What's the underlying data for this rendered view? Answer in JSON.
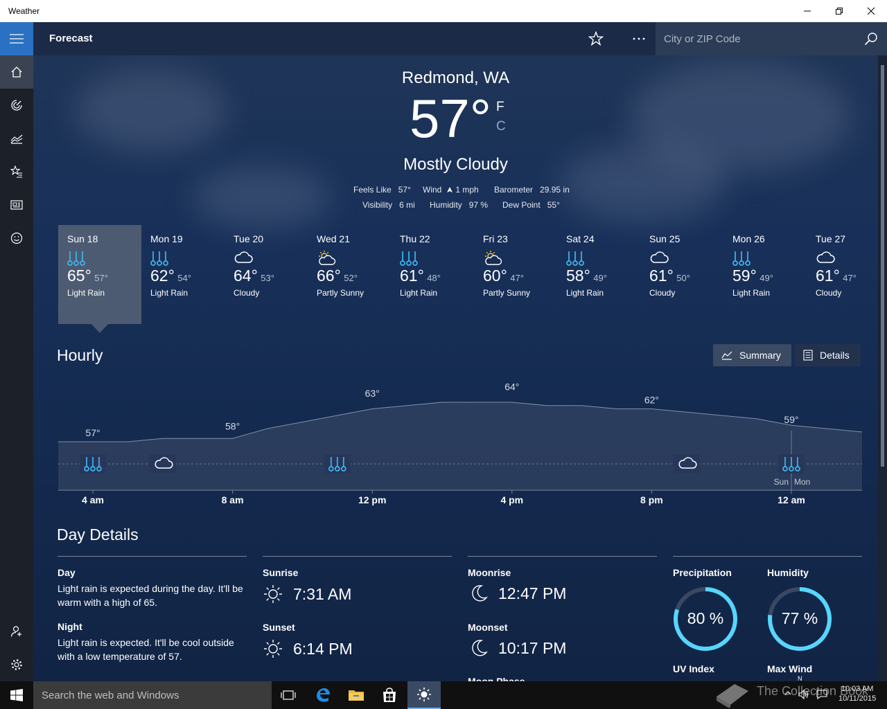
{
  "window": {
    "title": "Weather"
  },
  "topbar": {
    "title": "Forecast",
    "search_placeholder": "City or ZIP Code"
  },
  "current": {
    "location": "Redmond, WA",
    "temp": "57°",
    "unit_f": "F",
    "unit_c": "C",
    "condition": "Mostly Cloudy",
    "feels_like_label": "Feels Like",
    "feels_like": "57°",
    "wind_label": "Wind",
    "wind": "1 mph",
    "barometer_label": "Barometer",
    "barometer": "29.95 in",
    "visibility_label": "Visibility",
    "visibility": "6 mi",
    "humidity_label": "Humidity",
    "humidity": "97 %",
    "dewpoint_label": "Dew Point",
    "dewpoint": "55°"
  },
  "daily": [
    {
      "day": "Sun 18",
      "icon": "rain-icon",
      "hi": "65°",
      "lo": "57°",
      "desc": "Light Rain",
      "selected": true
    },
    {
      "day": "Mon 19",
      "icon": "rain-icon",
      "hi": "62°",
      "lo": "54°",
      "desc": "Light Rain"
    },
    {
      "day": "Tue 20",
      "icon": "cloud-icon",
      "hi": "64°",
      "lo": "53°",
      "desc": "Cloudy"
    },
    {
      "day": "Wed 21",
      "icon": "partly-sunny-icon",
      "hi": "66°",
      "lo": "52°",
      "desc": "Partly Sunny"
    },
    {
      "day": "Thu 22",
      "icon": "rain-icon",
      "hi": "61°",
      "lo": "48°",
      "desc": "Light Rain"
    },
    {
      "day": "Fri 23",
      "icon": "partly-sunny-icon",
      "hi": "60°",
      "lo": "47°",
      "desc": "Partly Sunny"
    },
    {
      "day": "Sat 24",
      "icon": "rain-icon",
      "hi": "58°",
      "lo": "49°",
      "desc": "Light Rain"
    },
    {
      "day": "Sun 25",
      "icon": "cloud-icon",
      "hi": "61°",
      "lo": "50°",
      "desc": "Cloudy"
    },
    {
      "day": "Mon 26",
      "icon": "rain-icon",
      "hi": "59°",
      "lo": "49°",
      "desc": "Light Rain"
    },
    {
      "day": "Tue 27",
      "icon": "cloud-icon",
      "hi": "61°",
      "lo": "47°",
      "desc": "Cloudy"
    }
  ],
  "hourly": {
    "title": "Hourly",
    "summary_label": "Summary",
    "details_label": "Details",
    "time_labels": [
      "4 am",
      "8 am",
      "12 pm",
      "4 pm",
      "8 pm",
      "12 am"
    ],
    "temp_labels": [
      "57°",
      "58°",
      "63°",
      "64°",
      "62°",
      "59°"
    ],
    "day_break_labels": [
      "Sun",
      "Mon"
    ]
  },
  "chart_data": {
    "type": "area",
    "x": [
      "4 am",
      "5 am",
      "6 am",
      "7 am",
      "8 am",
      "9 am",
      "10 am",
      "11 am",
      "12 pm",
      "1 pm",
      "2 pm",
      "3 pm",
      "4 pm",
      "5 pm",
      "6 pm",
      "7 pm",
      "8 pm",
      "9 pm",
      "10 pm",
      "11 pm",
      "12 am",
      "1 am",
      "2 am"
    ],
    "values": [
      57,
      57,
      57.5,
      57.5,
      57.5,
      59,
      60,
      61,
      62,
      62.5,
      63,
      63,
      63,
      62.5,
      62.5,
      62,
      62,
      61.5,
      61,
      60.5,
      59.5,
      59,
      58.5
    ],
    "labeled": [
      {
        "x": "4 am",
        "y": 57
      },
      {
        "x": "8 am",
        "y": 58
      },
      {
        "x": "12 pm",
        "y": 63
      },
      {
        "x": "4 pm",
        "y": 64
      },
      {
        "x": "8 pm",
        "y": 62
      },
      {
        "x": "12 am",
        "y": 59
      }
    ],
    "icons": [
      {
        "x": "4 am",
        "icon": "rain-icon"
      },
      {
        "x": "6 am",
        "icon": "cloud-icon"
      },
      {
        "x": "11 am",
        "icon": "rain-icon"
      },
      {
        "x": "9 pm",
        "icon": "cloud-icon"
      },
      {
        "x": "12 am",
        "icon": "rain-icon"
      }
    ],
    "grid": false
  },
  "day_details": {
    "title": "Day Details",
    "day_label": "Day",
    "day_text": "Light rain is expected during the day. It'll be warm with a high of 65.",
    "night_label": "Night",
    "night_text": "Light rain is expected. It'll be cool outside with a low temperature of 57.",
    "sunrise_label": "Sunrise",
    "sunrise": "7:31 AM",
    "sunset_label": "Sunset",
    "sunset": "6:14 PM",
    "moonrise_label": "Moonrise",
    "moonrise": "12:47 PM",
    "moonset_label": "Moonset",
    "moonset": "10:17 PM",
    "moon_phase_label": "Moon Phase",
    "precip_label": "Precipitation",
    "precip": "80 %",
    "precip_value": 0.8,
    "humidity_label": "Humidity",
    "humidity": "77 %",
    "humidity_value": 0.77,
    "uv_label": "UV Index",
    "maxwind_label": "Max Wind",
    "compass_n": "N"
  },
  "taskbar": {
    "search_placeholder": "Search the web and Windows",
    "time": "10:03 AM",
    "date": "10/11/2015",
    "watermark": "The Collection Book"
  },
  "colors": {
    "accent": "#2a71c3",
    "ring": "#56d6ff",
    "icon_blue": "#3fb6f0"
  }
}
